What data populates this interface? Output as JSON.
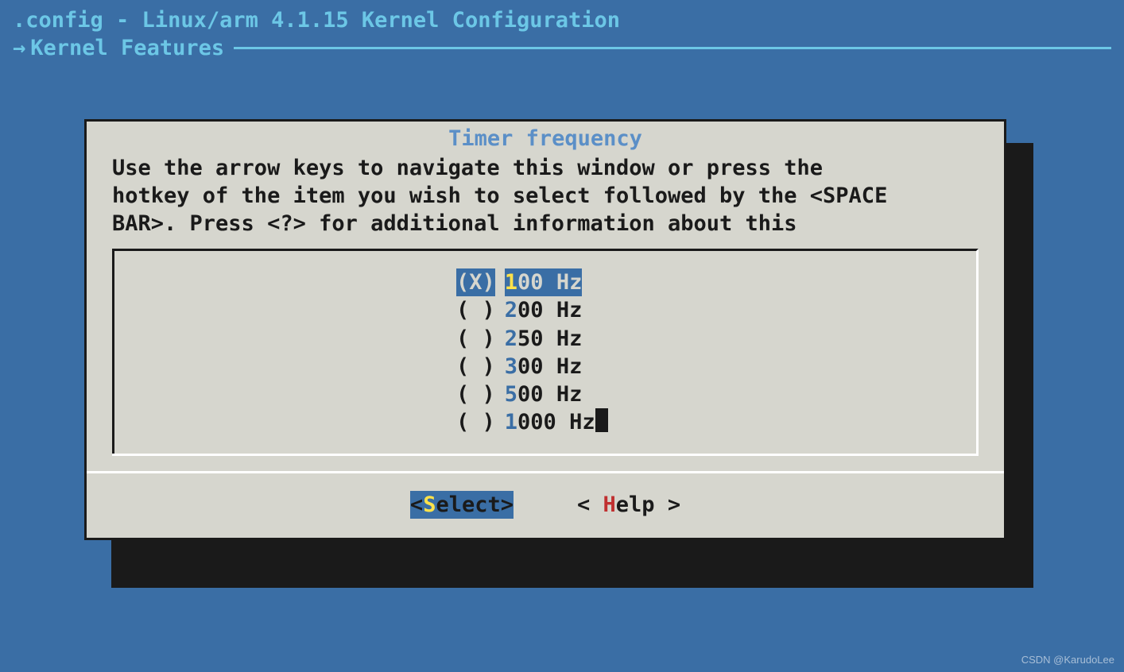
{
  "header": {
    "title": ".config - Linux/arm 4.1.15 Kernel Configuration",
    "arrow": "→",
    "breadcrumb": "Kernel Features"
  },
  "dialog": {
    "title": "Timer frequency",
    "instructions": "Use the arrow keys to navigate this window or press the\nhotkey of the item you wish to select followed by the <SPACE\nBAR>. Press <?> for additional information about this",
    "options": [
      {
        "radio": "(X)",
        "hotkey": "1",
        "rest": "00 Hz",
        "selected": true
      },
      {
        "radio": "( )",
        "hotkey": "2",
        "rest": "00 Hz",
        "selected": false
      },
      {
        "radio": "( )",
        "hotkey": "2",
        "rest": "50 Hz",
        "selected": false
      },
      {
        "radio": "( )",
        "hotkey": "3",
        "rest": "00 Hz",
        "selected": false
      },
      {
        "radio": "( )",
        "hotkey": "5",
        "rest": "00 Hz",
        "selected": false
      },
      {
        "radio": "( )",
        "hotkey": "1",
        "rest": "000 Hz",
        "selected": false,
        "cursor": true
      }
    ],
    "buttons": {
      "select": {
        "open": "<",
        "hot": "S",
        "rest": "elect",
        "close": ">"
      },
      "help": {
        "open": "< ",
        "hot": "H",
        "rest": "elp",
        "close": " >"
      }
    }
  },
  "watermark": "CSDN @KarudoLee"
}
